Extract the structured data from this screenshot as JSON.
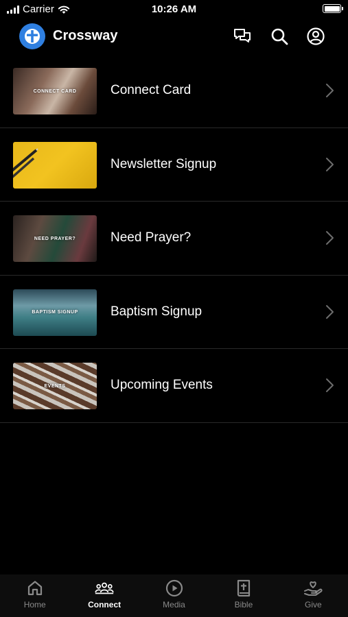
{
  "status_bar": {
    "carrier": "Carrier",
    "time": "10:26 AM"
  },
  "header": {
    "title": "Crossway",
    "icons": [
      "chat-icon",
      "search-icon",
      "profile-icon"
    ]
  },
  "items": [
    {
      "label": "Connect Card",
      "thumb_text": "CONNECT CARD"
    },
    {
      "label": "Newsletter Signup",
      "thumb_text": ""
    },
    {
      "label": "Need Prayer?",
      "thumb_text": "NEED PRAYER?"
    },
    {
      "label": "Baptism Signup",
      "thumb_text": "BAPTISM SIGNUP"
    },
    {
      "label": "Upcoming Events",
      "thumb_text": "EVENTS"
    }
  ],
  "tabs": [
    {
      "label": "Home",
      "icon": "home-icon",
      "active": false
    },
    {
      "label": "Connect",
      "icon": "people-icon",
      "active": true
    },
    {
      "label": "Media",
      "icon": "play-icon",
      "active": false
    },
    {
      "label": "Bible",
      "icon": "bible-icon",
      "active": false
    },
    {
      "label": "Give",
      "icon": "give-icon",
      "active": false
    }
  ],
  "colors": {
    "accent": "#2f7fe0",
    "background": "#000000",
    "newsletter_yellow": "#f2c320"
  }
}
